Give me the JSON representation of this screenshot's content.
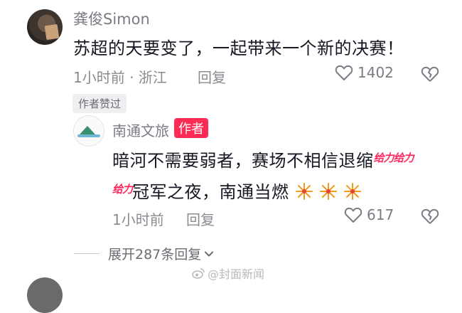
{
  "comment_top": {
    "username": "龚俊Simon",
    "text": "苏超的天要变了，一起带来一个新的决赛！",
    "time_location": "1小时前 · 浙江",
    "reply_label": "回复",
    "like_count": "1402",
    "author_liked_badge": "作者赞过"
  },
  "author_reply": {
    "username": "南通文旅",
    "author_tag": "作者",
    "line1_text": "暗河不需要弱者，赛场不相信退缩",
    "sticker_text_1": "给力给力",
    "sticker_text_2": "给力",
    "line2_text": "冠军之夜，南通当燃",
    "time": "1小时前",
    "reply_label": "回复",
    "like_count": "617"
  },
  "expand_replies": "展开287条回复",
  "watermark": "@封面新闻",
  "colors": {
    "author_tag_bg": "#fe2c55",
    "sticker_text": "#ff2a5e",
    "meta_text": "#8a8b91"
  },
  "icons": [
    "heart-icon",
    "heart-broken-icon",
    "chevron-down-icon",
    "weibo-icon",
    "firework-emoji"
  ]
}
